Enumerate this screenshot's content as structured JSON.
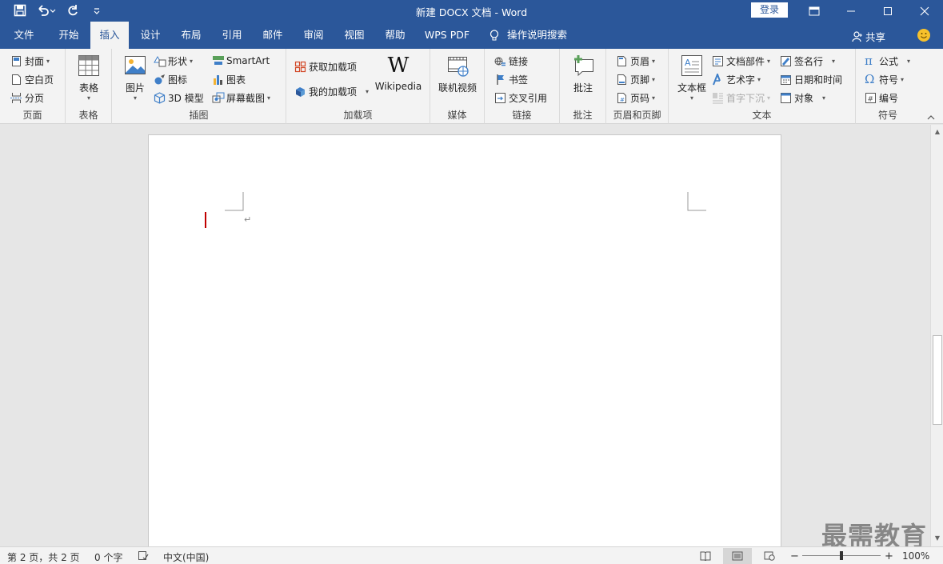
{
  "window": {
    "title": "新建 DOCX 文档  -  Word",
    "login_label": "登录"
  },
  "tabs": [
    {
      "label": "文件"
    },
    {
      "label": "开始"
    },
    {
      "label": "插入"
    },
    {
      "label": "设计"
    },
    {
      "label": "布局"
    },
    {
      "label": "引用"
    },
    {
      "label": "邮件"
    },
    {
      "label": "审阅"
    },
    {
      "label": "视图"
    },
    {
      "label": "帮助"
    },
    {
      "label": "WPS PDF"
    },
    {
      "label": "操作说明搜索"
    }
  ],
  "share_label": "共享",
  "ribbon": {
    "page_group": {
      "label": "页面",
      "cover": "封面",
      "blank": "空白页",
      "break": "分页"
    },
    "table_group": {
      "label": "表格",
      "table": "表格"
    },
    "illus_group": {
      "label": "插图",
      "picture": "图片",
      "shapes": "形状",
      "icons": "图标",
      "model3d": "3D 模型",
      "smartart": "SmartArt",
      "chart": "图表",
      "screenshot": "屏幕截图"
    },
    "addin_group": {
      "label": "加载项",
      "get": "获取加载项",
      "mine": "我的加载项",
      "wiki": "Wikipedia"
    },
    "media_group": {
      "label": "媒体",
      "video": "联机视频"
    },
    "link_group": {
      "label": "链接",
      "link": "链接",
      "bookmark": "书签",
      "xref": "交叉引用"
    },
    "comment_group": {
      "label": "批注",
      "comment": "批注"
    },
    "hf_group": {
      "label": "页眉和页脚",
      "header": "页眉",
      "footer": "页脚",
      "pagenum": "页码"
    },
    "text_group": {
      "label": "文本",
      "textbox": "文本框",
      "parts": "文档部件",
      "wordart": "艺术字",
      "dropcap": "首字下沉",
      "sigline": "签名行",
      "datetime": "日期和时间",
      "object": "对象"
    },
    "symbol_group": {
      "label": "符号",
      "equation": "公式",
      "symbol": "符号",
      "number": "编号"
    }
  },
  "statusbar": {
    "page": "第 2 页，共 2 页",
    "words": "0 个字",
    "language": "中文(中国)",
    "zoom": "100%"
  },
  "watermark": "最需教育",
  "colors": {
    "accent": "#2b579a",
    "cursor": "#c00000"
  }
}
